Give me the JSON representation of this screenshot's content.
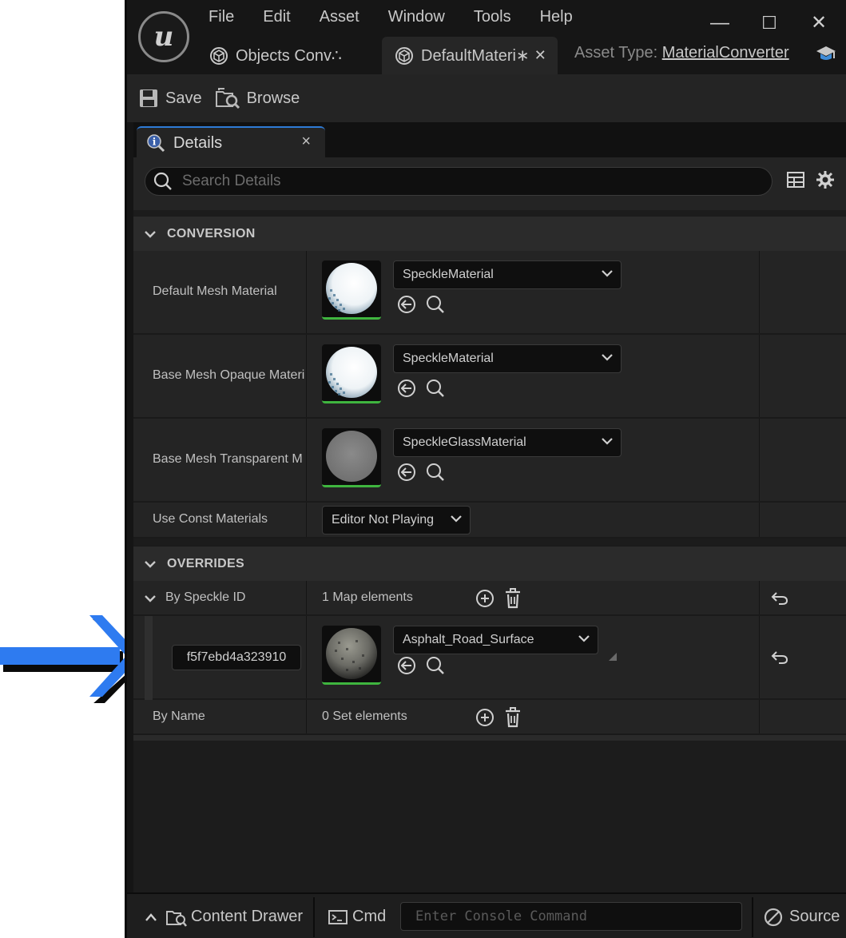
{
  "menu": [
    "File",
    "Edit",
    "Asset",
    "Window",
    "Tools",
    "Help"
  ],
  "window_controls": {
    "minimize": "—",
    "maximize": "☐",
    "close": "✕"
  },
  "tabs": [
    {
      "label": "Objects Conv∴"
    },
    {
      "label": "DefaultMateri∗",
      "close": "✕"
    }
  ],
  "asset_type": {
    "label": "Asset Type:",
    "value": "MaterialConverter"
  },
  "toolbar": {
    "save_label": "Save",
    "browse_label": "Browse"
  },
  "details": {
    "tab_label": "Details",
    "tab_close": "×",
    "search_placeholder": "Search Details"
  },
  "conversion": {
    "header": "CONVERSION",
    "rows": [
      {
        "name": "Default Mesh Material",
        "value": "SpeckleMaterial"
      },
      {
        "name": "Base Mesh Opaque Materi",
        "value": "SpeckleMaterial"
      },
      {
        "name": "Base Mesh Transparent M",
        "value": "SpeckleGlassMaterial"
      }
    ],
    "const_materials": {
      "name": "Use Const Materials",
      "value": "Editor Not Playing"
    }
  },
  "overrides": {
    "header": "OVERRIDES",
    "by_speckle_id": {
      "name": "By Speckle ID",
      "value": "1 Map elements"
    },
    "entry": {
      "key": "f5f7ebd4a323910",
      "value": "Asphalt_Road_Surface"
    },
    "by_name": {
      "name": "By Name",
      "value": "0 Set elements"
    }
  },
  "statusbar": {
    "content_drawer": "Content Drawer",
    "cmd": "Cmd",
    "console_placeholder": "Enter Console Command",
    "source": "Source"
  },
  "colors": {
    "arrow": "#2e7bf0",
    "accent": "#2e7bd6",
    "thumb_underline": "#3fb53f"
  }
}
